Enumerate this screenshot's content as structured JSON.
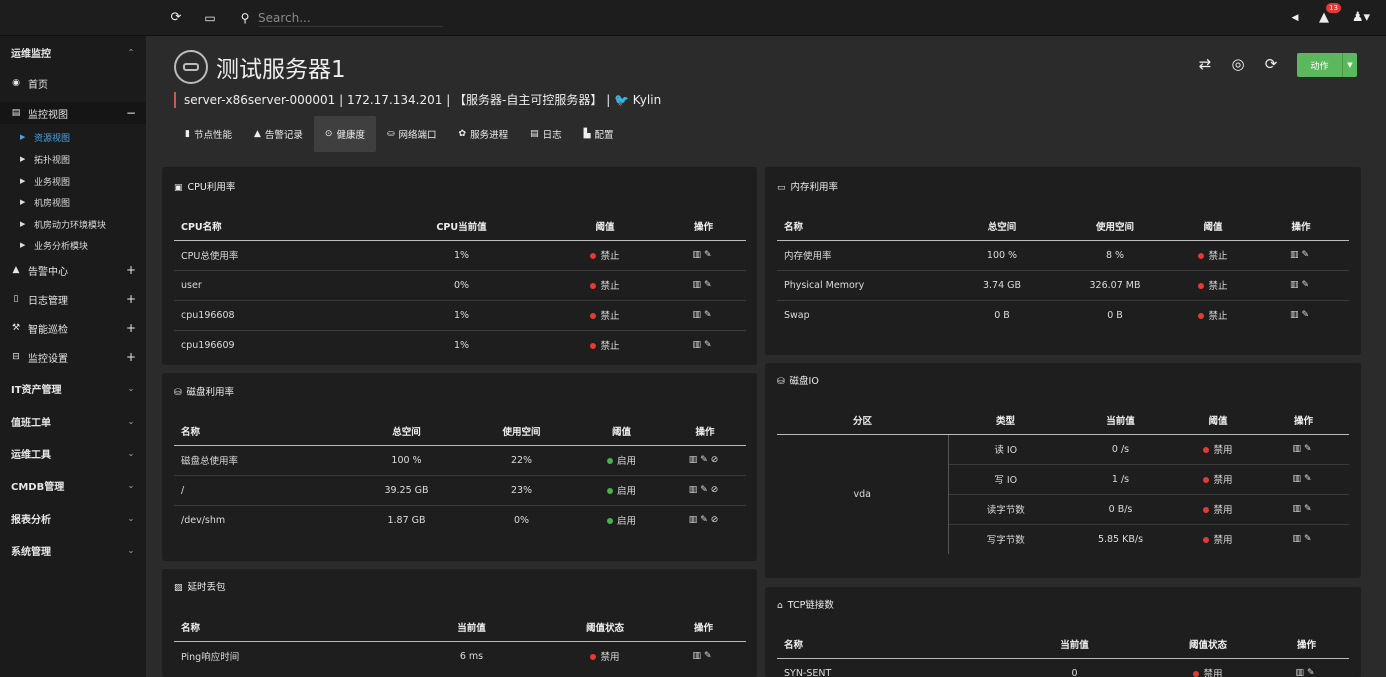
{
  "topbar": {
    "refresh_icon": "⟳",
    "monitor_icon": "🖥",
    "search_icon": "🔍",
    "search_placeholder": "Search...",
    "notification_count": "13"
  },
  "sidebar": {
    "groups": [
      {
        "label": "运维监控",
        "toggle": "⌃"
      },
      {
        "label": "IT资产管理",
        "toggle": "⌄"
      },
      {
        "label": "值班工单",
        "toggle": "⌄"
      },
      {
        "label": "运维工具",
        "toggle": "⌄"
      },
      {
        "label": "CMDB管理",
        "toggle": "⌄"
      },
      {
        "label": "报表分析",
        "toggle": "⌄"
      },
      {
        "label": "系统管理",
        "toggle": "⌄"
      }
    ],
    "items": [
      {
        "label": "首页",
        "toggle": ""
      },
      {
        "label": "监控视图",
        "toggle": "−"
      },
      {
        "label": "告警中心",
        "toggle": "+"
      },
      {
        "label": "日志管理",
        "toggle": "+"
      },
      {
        "label": "智能巡检",
        "toggle": "+"
      },
      {
        "label": "监控设置",
        "toggle": "+"
      }
    ],
    "subitems": [
      {
        "label": "资源视图"
      },
      {
        "label": "拓扑视图"
      },
      {
        "label": "业务视图"
      },
      {
        "label": "机房视图"
      },
      {
        "label": "机房动力环境模块"
      },
      {
        "label": "业务分析模块"
      }
    ]
  },
  "header": {
    "title": "测试服务器1",
    "info": "server-x86server-000001 | 172.17.134.201 | 【服务器-自主可控服务器】 | 🐦 Kylin",
    "action_label": "动作"
  },
  "tabs": [
    {
      "icon": "▮",
      "label": "节点性能"
    },
    {
      "icon": "▲",
      "label": "告警记录"
    },
    {
      "icon": "⊙",
      "label": "健康度"
    },
    {
      "icon": "⛀",
      "label": "网络端口"
    },
    {
      "icon": "✿",
      "label": "服务进程"
    },
    {
      "icon": "▤",
      "label": "日志"
    },
    {
      "icon": "▙",
      "label": "配置"
    }
  ],
  "cpu": {
    "title": "CPU利用率",
    "headers": [
      "CPU名称",
      "CPU当前值",
      "阈值",
      "操作"
    ],
    "rows": [
      {
        "name": "CPU总使用率",
        "value": "1%",
        "threshold": "禁止"
      },
      {
        "name": "user",
        "value": "0%",
        "threshold": "禁止"
      },
      {
        "name": "cpu196608",
        "value": "1%",
        "threshold": "禁止"
      },
      {
        "name": "cpu196609",
        "value": "1%",
        "threshold": "禁止"
      }
    ]
  },
  "memory": {
    "title": "内存利用率",
    "headers": [
      "名称",
      "总空间",
      "使用空间",
      "阈值",
      "操作"
    ],
    "rows": [
      {
        "name": "内存使用率",
        "total": "100 %",
        "used": "8 %",
        "threshold": "禁止"
      },
      {
        "name": "Physical Memory",
        "total": "3.74 GB",
        "used": "326.07 MB",
        "threshold": "禁止"
      },
      {
        "name": "Swap",
        "total": "0 B",
        "used": "0 B",
        "threshold": "禁止"
      }
    ]
  },
  "disk": {
    "title": "磁盘利用率",
    "headers": [
      "名称",
      "总空间",
      "使用空间",
      "阈值",
      "操作"
    ],
    "rows": [
      {
        "name": "磁盘总使用率",
        "total": "100 %",
        "used": "22%",
        "threshold": "启用"
      },
      {
        "name": "/",
        "total": "39.25 GB",
        "used": "23%",
        "threshold": "启用"
      },
      {
        "name": "/dev/shm",
        "total": "1.87 GB",
        "used": "0%",
        "threshold": "启用"
      }
    ]
  },
  "diskio": {
    "title": "磁盘IO",
    "headers": [
      "分区",
      "类型",
      "当前值",
      "阈值",
      "操作"
    ],
    "partition": "vda",
    "rows": [
      {
        "type": "读 IO",
        "value": "0 /s",
        "threshold": "禁用"
      },
      {
        "type": "写 IO",
        "value": "1 /s",
        "threshold": "禁用"
      },
      {
        "type": "读字节数",
        "value": "0 B/s",
        "threshold": "禁用"
      },
      {
        "type": "写字节数",
        "value": "5.85 KB/s",
        "threshold": "禁用"
      }
    ]
  },
  "latency": {
    "title": "延时丢包",
    "headers": [
      "名称",
      "当前值",
      "阈值状态",
      "操作"
    ],
    "rows": [
      {
        "name": "Ping响应时间",
        "value": "6 ms",
        "threshold": "禁用"
      }
    ]
  },
  "tcp": {
    "title": "TCP链接数",
    "headers": [
      "名称",
      "当前值",
      "阈值状态",
      "操作"
    ],
    "rows": [
      {
        "name": "SYN-SENT",
        "value": "0",
        "threshold": "禁用"
      }
    ]
  },
  "icons": {
    "chart": "📊",
    "edit": "✎",
    "ban": "⊘"
  },
  "colors": {
    "accent_green": "#5cb85c",
    "status_red": "#e53935",
    "status_green": "#4caf50",
    "active_link": "#4aa3df",
    "danger_text": "#e06666",
    "teal_text": "#1abc9c"
  }
}
